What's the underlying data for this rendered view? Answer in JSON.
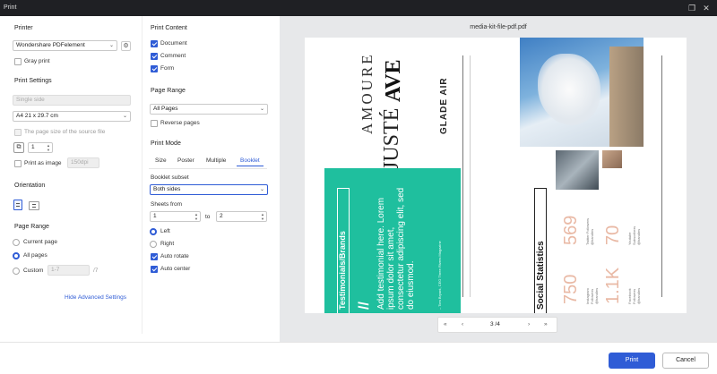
{
  "window": {
    "title": "Print"
  },
  "printer": {
    "section": "Printer",
    "selected": "Wondershare PDFelement",
    "gray_print": "Gray print"
  },
  "print_settings": {
    "section": "Print Settings",
    "sides_placeholder": "Single side",
    "paper": "A4 21 x 29.7 cm",
    "source_size": "The page size of the source file",
    "copies": "1",
    "print_as_image": "Print as image",
    "dpi_placeholder": "150dpi"
  },
  "orientation": {
    "section": "Orientation"
  },
  "page_range_left": {
    "section": "Page Range",
    "current": "Current page",
    "all": "All pages",
    "custom": "Custom",
    "custom_placeholder": "1-7",
    "total": "/7"
  },
  "advanced_link": "Hide Advanced Settings",
  "print_content": {
    "section": "Print Content",
    "document": "Document",
    "comment": "Comment",
    "form": "Form"
  },
  "page_range_mid": {
    "section": "Page Range",
    "selected": "All Pages",
    "reverse": "Reverse pages"
  },
  "print_mode": {
    "section": "Print Mode",
    "tabs": [
      "Size",
      "Poster",
      "Multiple",
      "Booklet"
    ],
    "booklet_subset_label": "Booklet subset",
    "booklet_subset": "Both sides",
    "sheets_from_label": "Sheets from",
    "sheets_from": "1",
    "to_label": "to",
    "sheets_to": "2",
    "left": "Left",
    "right": "Right",
    "auto_rotate": "Auto rotate",
    "auto_center": "Auto center"
  },
  "preview": {
    "filename": "media-kit-file-pdf.pdf",
    "page_label": "3 /4",
    "content": {
      "amoure": "AMOURE",
      "juste": "JUSTÉ",
      "ave": "AVE",
      "glade": "GLADE AIR",
      "testimonials": "Testimonials/Brands",
      "quote": "Add testimonial here. Lorem ipsum dolor sit amet, consectetur adipiscing elit, sed do eiusmod.",
      "quote_author": "– Tom Bryant, CEO Three Rivers Magazine",
      "social": "Social Statistics",
      "stat1": "750",
      "stat1_label": "Instagram Followers @handles",
      "stat2": "1.1K",
      "stat2_label": "Facebook Followers @handles",
      "stat3": "569",
      "stat3_label": "Twitter Followers @handles",
      "stat4": "70",
      "stat4_label": "Youtube Subscribers @handles"
    }
  },
  "footer": {
    "print": "Print",
    "cancel": "Cancel"
  },
  "colors": {
    "accent": "#2f5cd6",
    "teal": "#1fbf9e",
    "peach": "#e9b9a5"
  }
}
